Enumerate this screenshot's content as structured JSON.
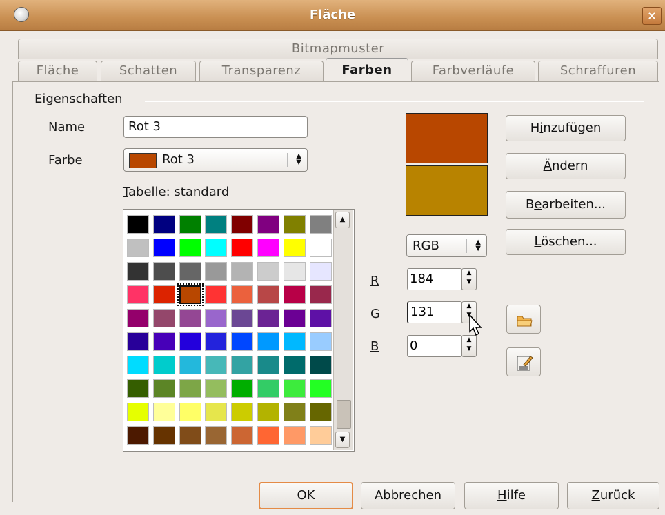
{
  "window": {
    "title": "Fläche",
    "close_label": "×"
  },
  "tabs_top": [
    {
      "label": "Bitmapmuster"
    }
  ],
  "tabs": [
    {
      "label": "Fläche"
    },
    {
      "label": "Schatten"
    },
    {
      "label": "Transparenz"
    },
    {
      "label": "Farben",
      "active": true
    },
    {
      "label": "Farbverläufe"
    },
    {
      "label": "Schraffuren"
    }
  ],
  "section": {
    "label": "Eigenschaften"
  },
  "name_field": {
    "mnemonic": "N",
    "rest": "ame",
    "value": "Rot 3"
  },
  "color_field": {
    "mnemonic": "F",
    "rest": "arbe",
    "value": "Rot 3",
    "swatch_color": "#b84700"
  },
  "table": {
    "mnemonic": "T",
    "rest": "abelle: standard"
  },
  "palette": [
    [
      "#000000",
      "#000080",
      "#008000",
      "#008080",
      "#800000",
      "#800080",
      "#808000",
      "#808080"
    ],
    [
      "#c0c0c0",
      "#0000ff",
      "#00ff00",
      "#00ffff",
      "#ff0000",
      "#ff00ff",
      "#ffff00",
      "#ffffff"
    ],
    [
      "#333333",
      "#4d4d4d",
      "#666666",
      "#999999",
      "#b3b3b3",
      "#cccccc",
      "#e6e6e6",
      "#e6e6ff"
    ],
    [
      "#ff3366",
      "#dc2300",
      "#b84700",
      "#ff3333",
      "#eb613d",
      "#b84747",
      "#b80047",
      "#99284c"
    ],
    [
      "#94006b",
      "#94476b",
      "#944794",
      "#9966cc",
      "#6b4794",
      "#6b2394",
      "#6b0094",
      "#5e11a6"
    ],
    [
      "#280099",
      "#4700b8",
      "#2300dc",
      "#2323dc",
      "#0047ff",
      "#0099ff",
      "#00b8ff",
      "#99ccff"
    ],
    [
      "#00dcff",
      "#00cccc",
      "#23b8dc",
      "#47b8b8",
      "#33a3a3",
      "#198a8a",
      "#006b6b",
      "#004a4a"
    ],
    [
      "#355e00",
      "#5c8526",
      "#7da647",
      "#94bd5e",
      "#00ae00",
      "#33cc66",
      "#3deb3d",
      "#23ff23"
    ],
    [
      "#e6ff00",
      "#ffff99",
      "#ffff66",
      "#e6e64c",
      "#cccc00",
      "#b3b300",
      "#808019",
      "#666600"
    ],
    [
      "#4c1900",
      "#663300",
      "#804c19",
      "#996633",
      "#cc6633",
      "#ff6633",
      "#ff9966",
      "#ffcc99"
    ]
  ],
  "selected_cell": {
    "row": 3,
    "col": 2
  },
  "preview": {
    "new_color": "#b84700",
    "old_color": "#b88300"
  },
  "buttons": {
    "add": {
      "pre": "H",
      "mnemonic": "i",
      "rest": "nzufügen"
    },
    "modify": {
      "pre": "",
      "mnemonic": "Ä",
      "rest": "ndern"
    },
    "edit": {
      "pre": "B",
      "mnemonic": "e",
      "rest": "arbeiten..."
    },
    "delete": {
      "pre": "",
      "mnemonic": "L",
      "rest": "öschen..."
    }
  },
  "color_model": {
    "value": "RGB"
  },
  "channels": [
    {
      "label": "R",
      "value": "184"
    },
    {
      "label": "G",
      "value": "131"
    },
    {
      "label": "B",
      "value": "0"
    }
  ],
  "footer": {
    "ok": "OK",
    "cancel": "Abbrechen",
    "help_mnemonic": "H",
    "help_rest": "ilfe",
    "back_mnemonic": "Z",
    "back_rest": "urück"
  },
  "colors": {
    "accent": "#e48b46",
    "titlebar": "#c98f52"
  }
}
